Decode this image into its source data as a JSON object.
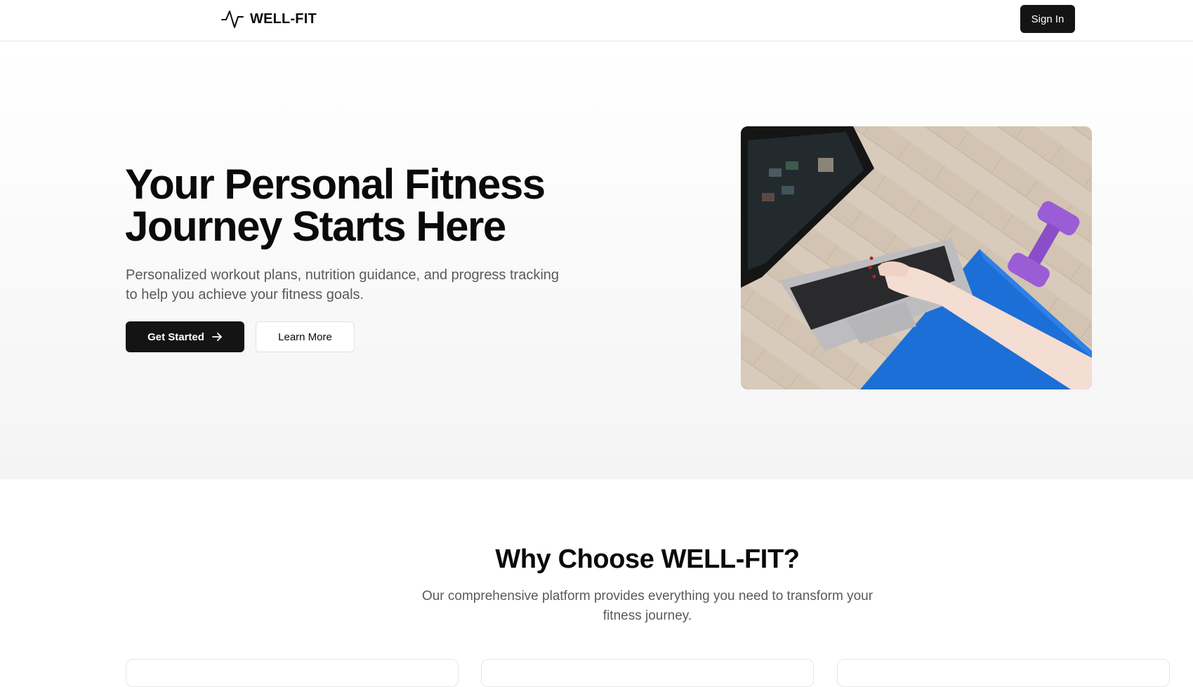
{
  "header": {
    "brand": "WELL-FIT",
    "logo_icon": "activity-pulse-icon",
    "sign_in_label": "Sign In"
  },
  "hero": {
    "title": "Your Personal Fitness Journey Starts Here",
    "subtitle": "Personalized workout plans, nutrition guidance, and progress tracking to help you achieve your fitness goals.",
    "primary_cta_label": "Get Started",
    "primary_cta_icon": "arrow-right-icon",
    "secondary_cta_label": "Learn More",
    "image_alt": "Laptop on wooden floor beside blue yoga mat and purple dumbbell"
  },
  "features": {
    "title": "Why Choose WELL-FIT?",
    "subtitle": "Our comprehensive platform provides everything you need to transform your fitness journey."
  },
  "colors": {
    "primary": "#141414",
    "text": "#0a0a0a",
    "muted_text": "#5a5a5a",
    "border": "#e6e6e6"
  }
}
